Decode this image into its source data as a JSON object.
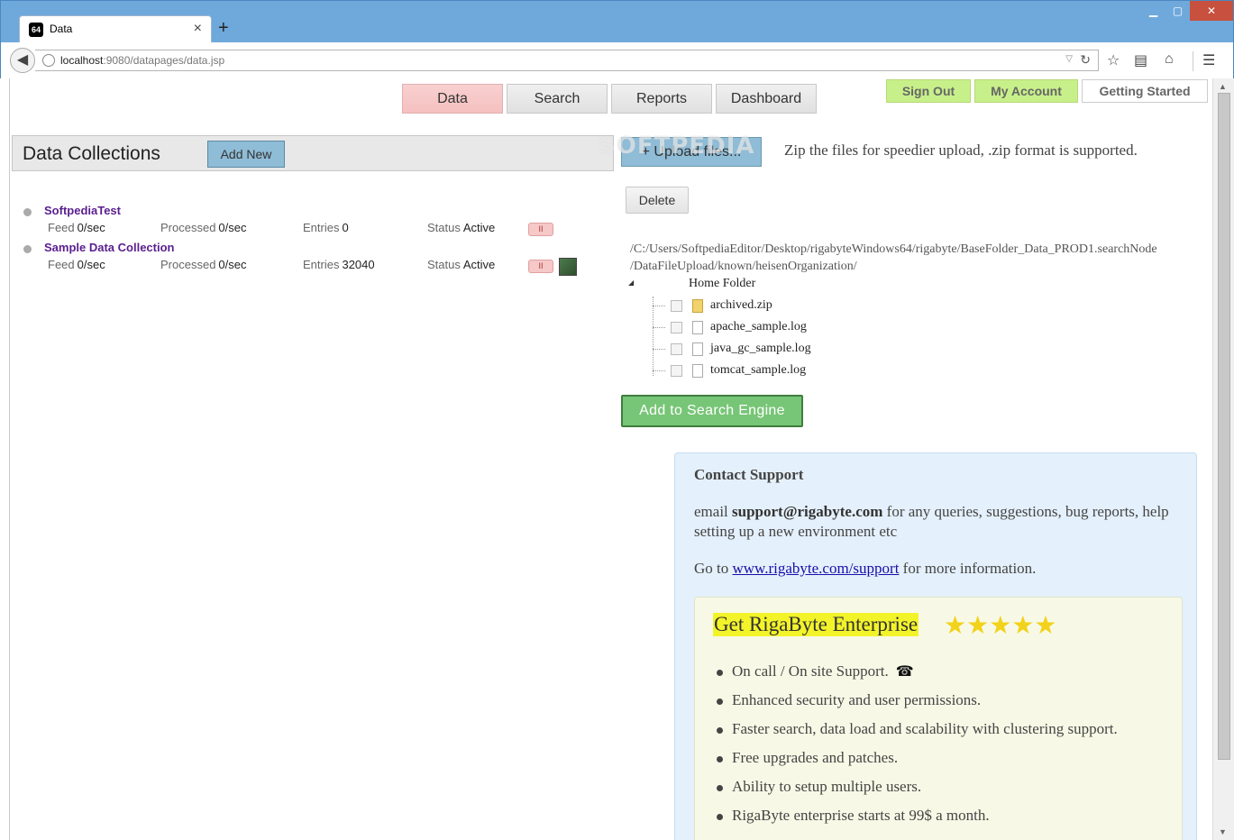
{
  "browser": {
    "tab_favicon": "64",
    "tab_title": "Data",
    "tab_close": "×",
    "new_tab": "+",
    "url_host": "localhost",
    "url_rest": ":9080/datapages/data.jsp",
    "icons": [
      "back-icon",
      "globe-icon",
      "reload-icon",
      "star-icon",
      "reading-list-icon",
      "home-icon",
      "menu-icon"
    ]
  },
  "main_nav": {
    "data": "Data",
    "search": "Search",
    "reports": "Reports",
    "dashboard": "Dashboard"
  },
  "account": {
    "sign_out": "Sign Out",
    "my_account": "My Account",
    "getting_started": "Getting Started"
  },
  "collections": {
    "title": "Data Collections",
    "add_new": "Add New",
    "items": [
      {
        "name": "SoftpediaTest",
        "feed_label": "Feed",
        "feed": "0/sec",
        "processed_label": "Processed",
        "processed": "0/sec",
        "entries_label": "Entries",
        "entries": "0",
        "status_label": "Status",
        "status": "Active",
        "pause": "II"
      },
      {
        "name": "Sample Data Collection",
        "feed_label": "Feed",
        "feed": "0/sec",
        "processed_label": "Processed",
        "processed": "0/sec",
        "entries_label": "Entries",
        "entries": "32040",
        "status_label": "Status",
        "status": "Active",
        "pause": "II"
      }
    ]
  },
  "upload": {
    "button": "Upload files...",
    "hint": "Zip the files for speedier upload, .zip format is supported.",
    "delete": "Delete",
    "path_line1": "/C:/Users/SoftpediaEditor/Desktop/rigabyteWindows64/rigabyte/BaseFolder_Data_PROD1.searchNode",
    "path_line2": "/DataFileUpload/known/heisenOrganization/",
    "home_folder": "Home Folder",
    "files": [
      "archived.zip",
      "apache_sample.log",
      "java_gc_sample.log",
      "tomcat_sample.log"
    ],
    "add_to_search": "Add to Search Engine"
  },
  "support": {
    "title": "Contact Support",
    "email_prefix": "email",
    "email": "support@rigabyte.com",
    "email_suffix": "for any queries, suggestions, bug reports, help setting up a new environment etc",
    "go_prefix": "Go to",
    "link": "www.rigabyte.com/support",
    "go_suffix": "for more information."
  },
  "enterprise": {
    "title": "Get RigaByte Enterprise",
    "stars": "★★★★★",
    "features": [
      "On call / On site Support.",
      "Enhanced security and user permissions.",
      "Faster search, data load and scalability with clustering support.",
      "Free upgrades and patches.",
      "Ability to setup multiple users.",
      "RigaByte enterprise starts at 99$ a month."
    ],
    "phone_icon": "☎"
  },
  "watermark": "SOFTPEDIA"
}
